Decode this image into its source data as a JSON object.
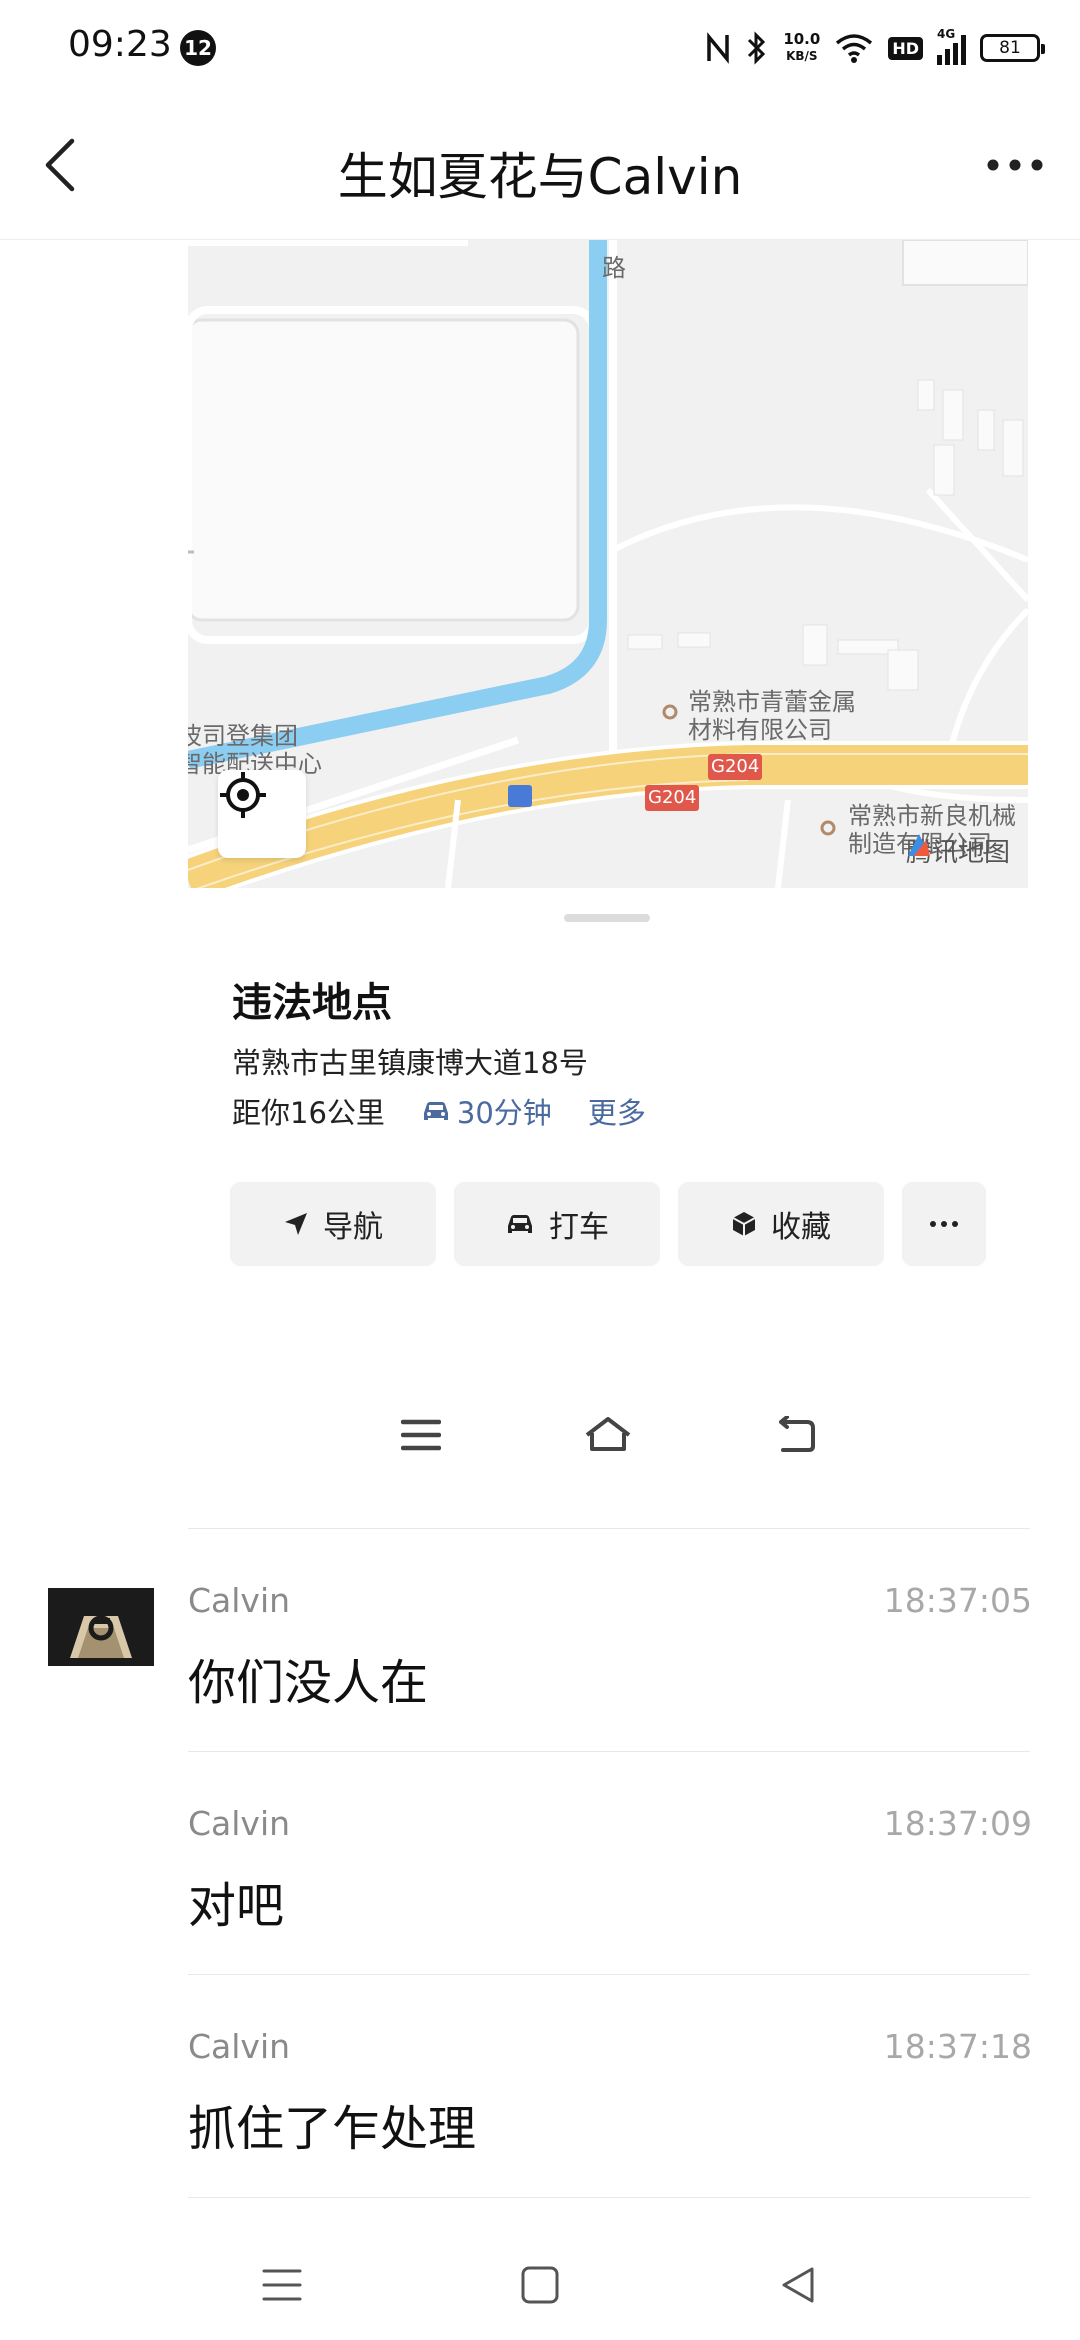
{
  "status_bar": {
    "time": "09:23",
    "notification_count": "12",
    "net_speed_value": "10.0",
    "net_speed_unit": "KB/S",
    "hd_label": "HD",
    "network_type": "4G",
    "battery": "81"
  },
  "header": {
    "title": "生如夏花与Calvin"
  },
  "map": {
    "road_label": "路",
    "poi_1": [
      "常熟市青蕾金属",
      "材料有限公司"
    ],
    "poi_2": [
      "常熟市新良机械",
      "制造有限公司"
    ],
    "poi_3": [
      "波司登集团",
      "智能配送中心"
    ],
    "highway_label": "G204",
    "logo_text": "腾讯地图"
  },
  "location": {
    "name": "违法地点",
    "address": "常熟市古里镇康博大道18号",
    "distance": "距你16公里",
    "drive_time": "30分钟",
    "more": "更多"
  },
  "actions": {
    "navigate": "导航",
    "taxi": "打车",
    "favorite": "收藏"
  },
  "messages": [
    {
      "sender": "Calvin",
      "time": "18:37:05",
      "text": "你们没人在"
    },
    {
      "sender": "Calvin",
      "time": "18:37:09",
      "text": "对吧"
    },
    {
      "sender": "Calvin",
      "time": "18:37:18",
      "text": "抓住了乍处理"
    }
  ],
  "icons": {
    "back": "chevron-left-icon",
    "more": "ellipsis-icon",
    "locate": "crosshair-icon",
    "navigate": "navigation-arrow-icon",
    "taxi": "car-icon",
    "favorite": "cube-icon"
  },
  "colors": {
    "accent_link": "#4a6aa0",
    "map_river": "#8ccdf2",
    "map_highway": "#f6d27a",
    "map_highway_label": "#e0574c"
  }
}
